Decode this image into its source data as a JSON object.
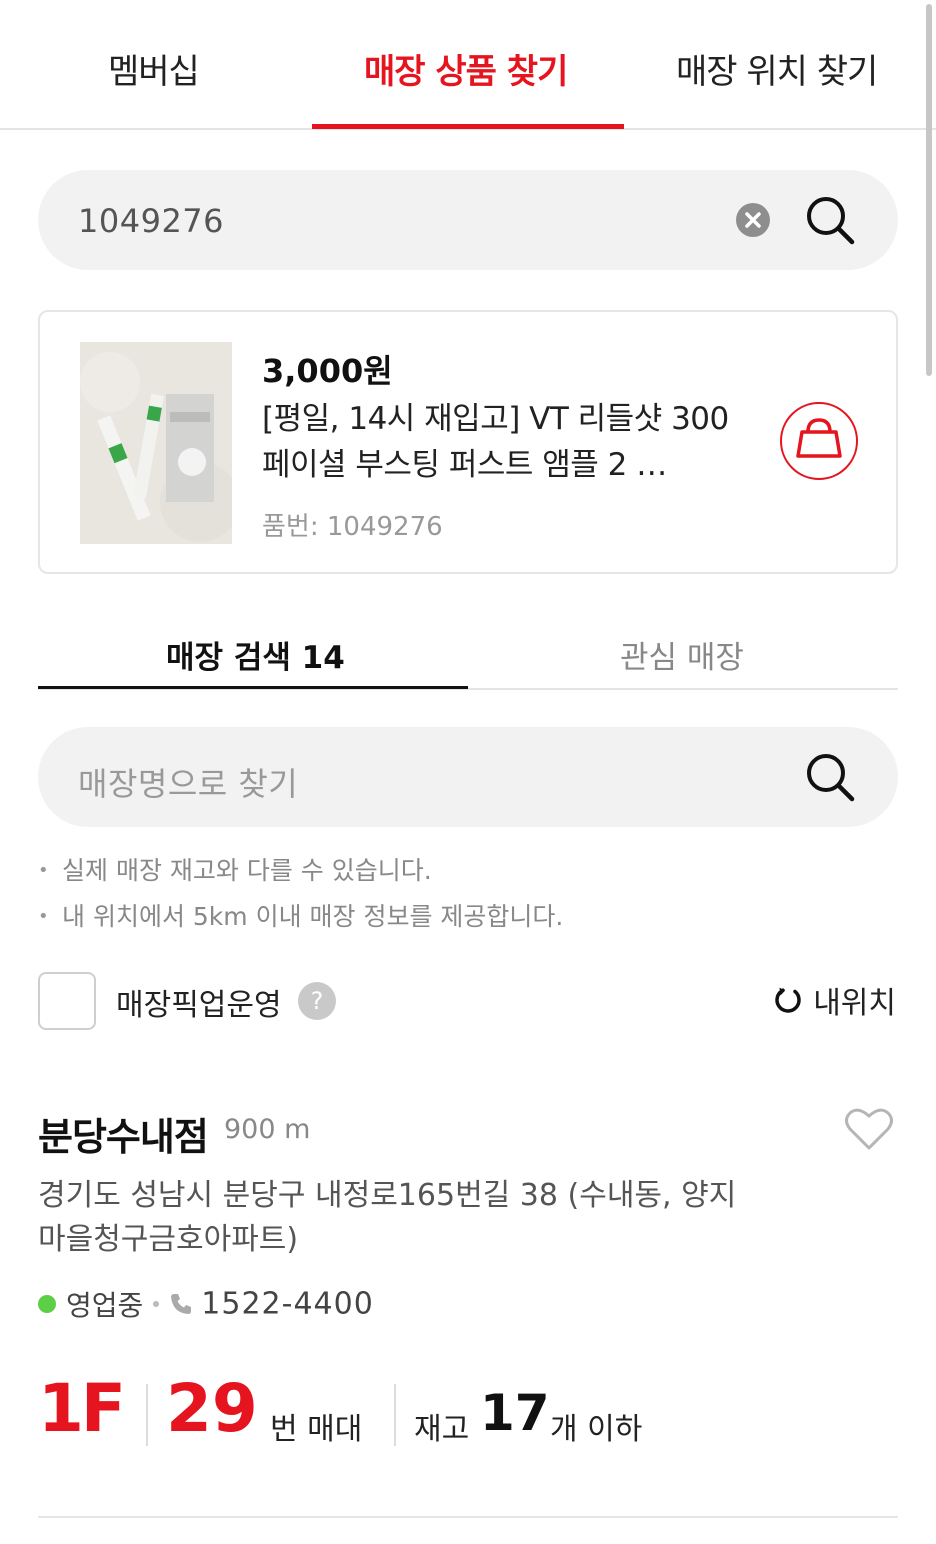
{
  "top_tabs": [
    {
      "label": "멤버십",
      "active": false
    },
    {
      "label": "매장 상품 찾기",
      "active": true
    },
    {
      "label": "매장 위치 찾기",
      "active": false
    }
  ],
  "product_search": {
    "value": "1049276",
    "clear_icon": "clear-icon",
    "search_icon": "search-icon"
  },
  "product": {
    "price": "3,000원",
    "name": "[평일, 14시 재입고] VT 리들샷 300 페이셜 부스팅 퍼스트 앰플 2 …",
    "code": "품번: 1049276",
    "bag_icon": "shopping-bag-icon"
  },
  "store_tabs": [
    {
      "label": "매장 검색 14",
      "active": true
    },
    {
      "label": "관심 매장",
      "active": false
    }
  ],
  "store_search": {
    "placeholder": "매장명으로 찾기",
    "search_icon": "search-icon"
  },
  "notes": [
    "실제 매장 재고와 다를 수 있습니다.",
    "내 위치에서 5km 이내 매장 정보를 제공합니다."
  ],
  "filter": {
    "pickup_label": "매장픽업운영",
    "help_symbol": "?",
    "my_location_label": "내위치"
  },
  "store": {
    "name": "분당수내점",
    "distance": "900 m",
    "address": "경기도 성남시 분당구 내정로165번길 38 (수내동, 양지마을청구금호아파트)",
    "status": "영업중",
    "phone": "1522-4400",
    "floor": "1F",
    "shelf_number": "29",
    "shelf_unit": "번 매대",
    "stock_label": "재고",
    "stock_count": "17",
    "stock_unit": "개 이하"
  },
  "colors": {
    "accent": "#e5141e",
    "open_status": "#5ccf46",
    "pill_bg": "#f2f2f2"
  }
}
